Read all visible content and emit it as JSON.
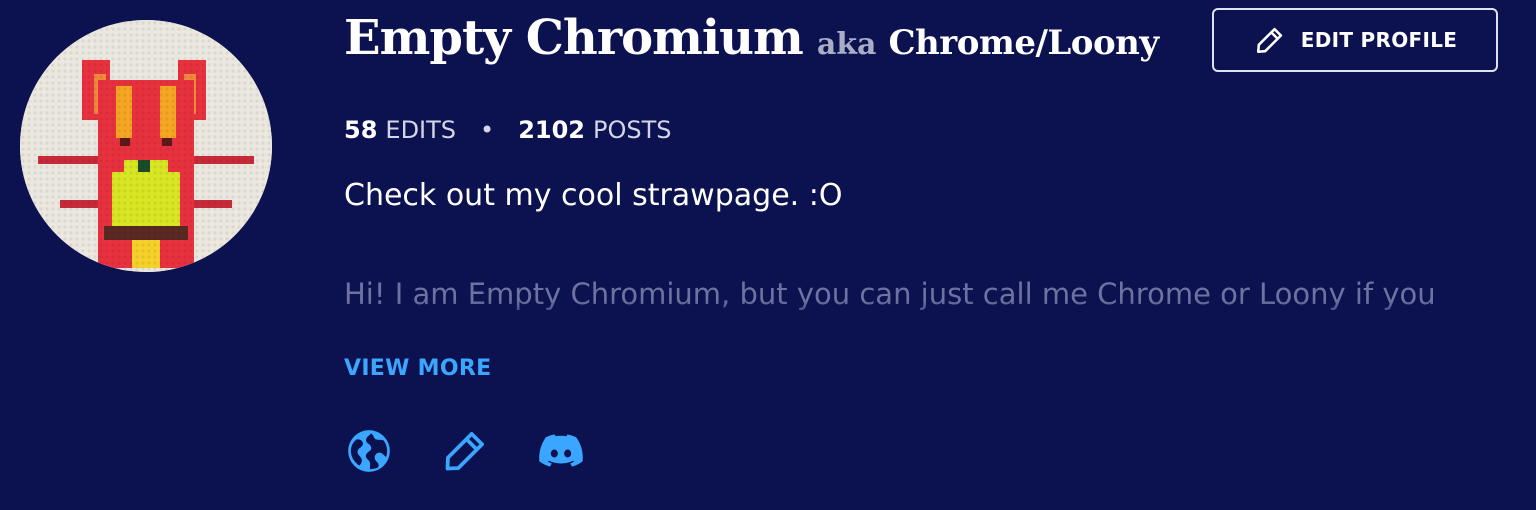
{
  "profile": {
    "display_name": "Empty Chromium",
    "aka_label": "aka",
    "alt_name": "Chrome/Loony",
    "avatar_icon": "red-pixel-cat-avatar",
    "edit_button_label": "EDIT PROFILE",
    "edit_button_icon": "pencil-icon"
  },
  "stats": {
    "edits_count": "58",
    "edits_label": "EDITS",
    "separator": "•",
    "posts_count": "2102",
    "posts_label": "POSTS"
  },
  "tagline": "Check out my cool strawpage. :O",
  "bio": {
    "text": "Hi! I am Empty Chromium, but you can just call me Chrome or Loony if you",
    "view_more_label": "VIEW MORE"
  },
  "links": [
    {
      "icon": "globe-icon"
    },
    {
      "icon": "pencil-icon"
    },
    {
      "icon": "discord-icon"
    }
  ],
  "colors": {
    "background": "#0c1150",
    "accent": "#3aa6ff",
    "muted_text": "#6e72a0"
  }
}
